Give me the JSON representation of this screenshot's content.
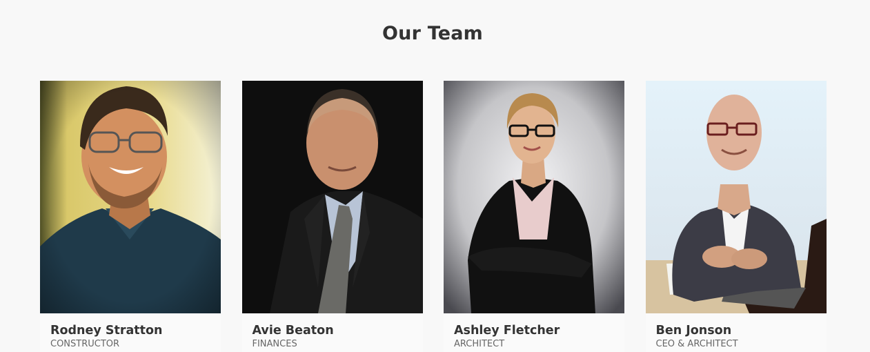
{
  "section": {
    "title": "Our Team"
  },
  "members": [
    {
      "name": "Rodney Stratton",
      "role": "CONSTRUCTOR",
      "photo_style": "warm-vintage",
      "background_color": "#c9b878",
      "shirt_color": "#1f3a4a"
    },
    {
      "name": "Avie Beaton",
      "role": "FINANCES",
      "photo_style": "dark-studio",
      "background_color": "#0e0e0e",
      "shirt_color": "#1a1a1a"
    },
    {
      "name": "Ashley Fletcher",
      "role": "ARCHITECT",
      "photo_style": "grey-studio",
      "background_color": "#c5c5c8",
      "shirt_color": "#111111"
    },
    {
      "name": "Ben Jonson",
      "role": "CEO & ARCHITECT",
      "photo_style": "bright-office",
      "background_color": "#e4eef4",
      "shirt_color": "#3c3c46"
    }
  ]
}
